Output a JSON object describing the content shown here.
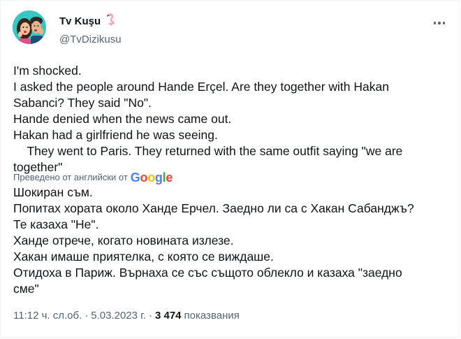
{
  "tweet": {
    "author": {
      "name": "Tv Kuşu",
      "handle": "@TvDizikusu",
      "name_emoji": "flamingo-icon"
    },
    "original_lines": [
      "I'm shocked.",
      "I asked the people around Hande Erçel. Are they together with Hakan",
      "Sabanci? They said \"No\".",
      "Hande denied when the news came out.",
      "Hakan had a girlfriend he was seeing.",
      "    They went to Paris. They returned with the same outfit saying \"we are",
      "together\""
    ],
    "translation": {
      "label": "Преведено от английски от",
      "provider": "Google",
      "lines": [
        "Шокиран съм.",
        "Попитах хората около Ханде Ерчел. Заедно ли са с Хакан Сабанджъ?",
        "Те казаха \"Не\".",
        "Ханде отрече, когато новината излезе.",
        "Хакан имаше приятелка, с която се виждаше.",
        "Отидоха в Париж. Върнаха се със същото облекло и казаха \"заедно",
        "сме\""
      ]
    },
    "meta": {
      "time": "11:12 ч. сл.об.",
      "separator": "·",
      "date": "5.03.2023 г.",
      "views_count": "3 474",
      "views_label": "показвания"
    }
  },
  "colors": {
    "text": "#0f1419",
    "secondary": "#536471",
    "border": "#eff3f4",
    "avatar_bg": "#37c6c0",
    "flamingo": "#f5a3b5",
    "google_blue": "#4285F4",
    "google_red": "#EA4335",
    "google_yellow": "#FBBC05",
    "google_green": "#34A853"
  }
}
